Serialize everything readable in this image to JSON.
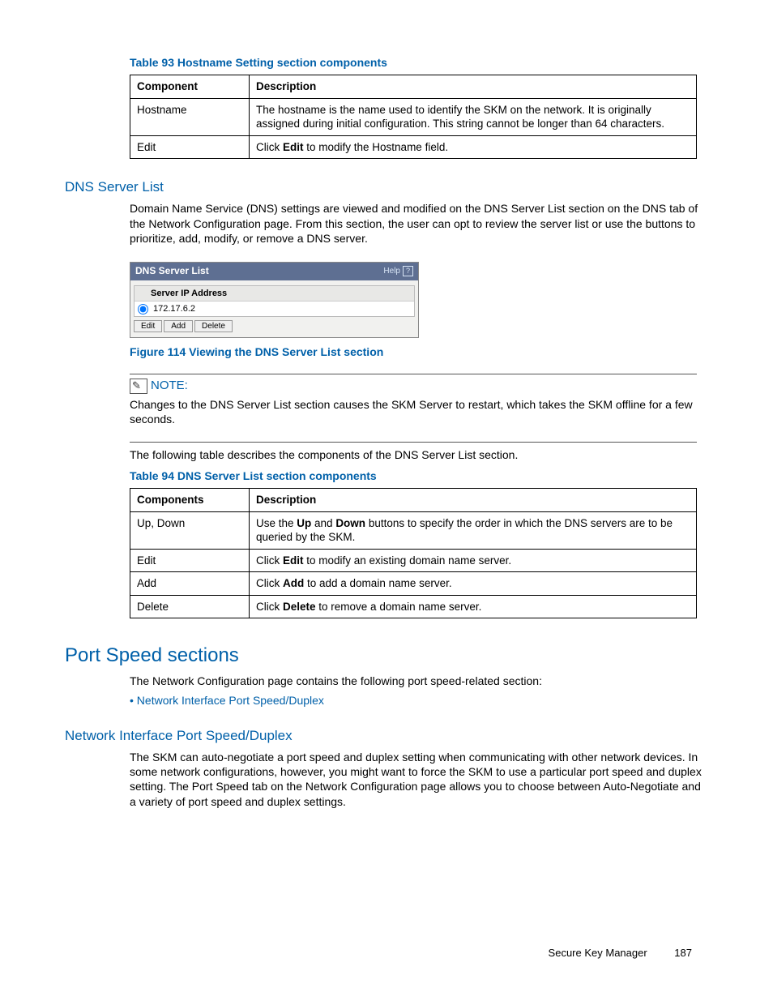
{
  "table93": {
    "caption": "Table 93 Hostname Setting section components",
    "headers": [
      "Component",
      "Description"
    ],
    "rows": [
      {
        "c1": "Hostname",
        "c2_pre": "The hostname is the name used to identify the SKM on the network. It is originally assigned during initial configuration. This string cannot be longer than 64 characters."
      },
      {
        "c1": "Edit",
        "c2_pre": "Click ",
        "c2_bold": "Edit",
        "c2_post": " to modify the Hostname field."
      }
    ]
  },
  "dns": {
    "heading": "DNS Server List",
    "para": "Domain Name Service (DNS) settings are viewed and modified on the DNS Server List section on the DNS tab of the Network Configuration page. From this section, the user can opt to review the server list or use the buttons to prioritize, add, modify, or remove a DNS server.",
    "box_title": "DNS Server List",
    "box_help": "Help",
    "col_header": "Server IP Address",
    "row_ip": "172.17.6.2",
    "btn_edit": "Edit",
    "btn_add": "Add",
    "btn_delete": "Delete",
    "fig_caption": "Figure 114 Viewing the DNS Server List section",
    "note_label": "NOTE:",
    "note_body": "Changes to the DNS Server List section causes the SKM Server to restart, which takes the SKM offline for a few seconds.",
    "lead_para": "The following table describes the components of the DNS Server List section."
  },
  "table94": {
    "caption": "Table 94 DNS Server List section components",
    "headers": [
      "Components",
      "Description"
    ],
    "rows": [
      {
        "c1": "Up, Down",
        "pre": "Use the ",
        "b1": "Up",
        "mid": " and ",
        "b2": "Down",
        "post": " buttons to specify the order in which the DNS servers are to be queried by the SKM."
      },
      {
        "c1": "Edit",
        "pre": "Click ",
        "b1": "Edit",
        "post": " to modify an existing domain name server."
      },
      {
        "c1": "Add",
        "pre": "Click ",
        "b1": "Add",
        "post": " to add a domain name server."
      },
      {
        "c1": "Delete",
        "pre": "Click ",
        "b1": "Delete",
        "post": " to remove a domain name server."
      }
    ]
  },
  "portspeed": {
    "heading": "Port Speed sections",
    "para": "The Network Configuration page contains the following port speed-related section:",
    "bullet": "Network Interface Port Speed/Duplex",
    "sub_heading": "Network Interface Port Speed/Duplex",
    "sub_para": "The SKM can auto-negotiate a port speed and duplex setting when communicating with other network devices. In some network configurations, however, you might want to force the SKM to use a particular port speed and duplex setting. The Port Speed tab on the Network Configuration page allows you to choose between Auto-Negotiate and a variety of port speed and duplex settings."
  },
  "footer": {
    "title": "Secure Key Manager",
    "page": "187"
  }
}
